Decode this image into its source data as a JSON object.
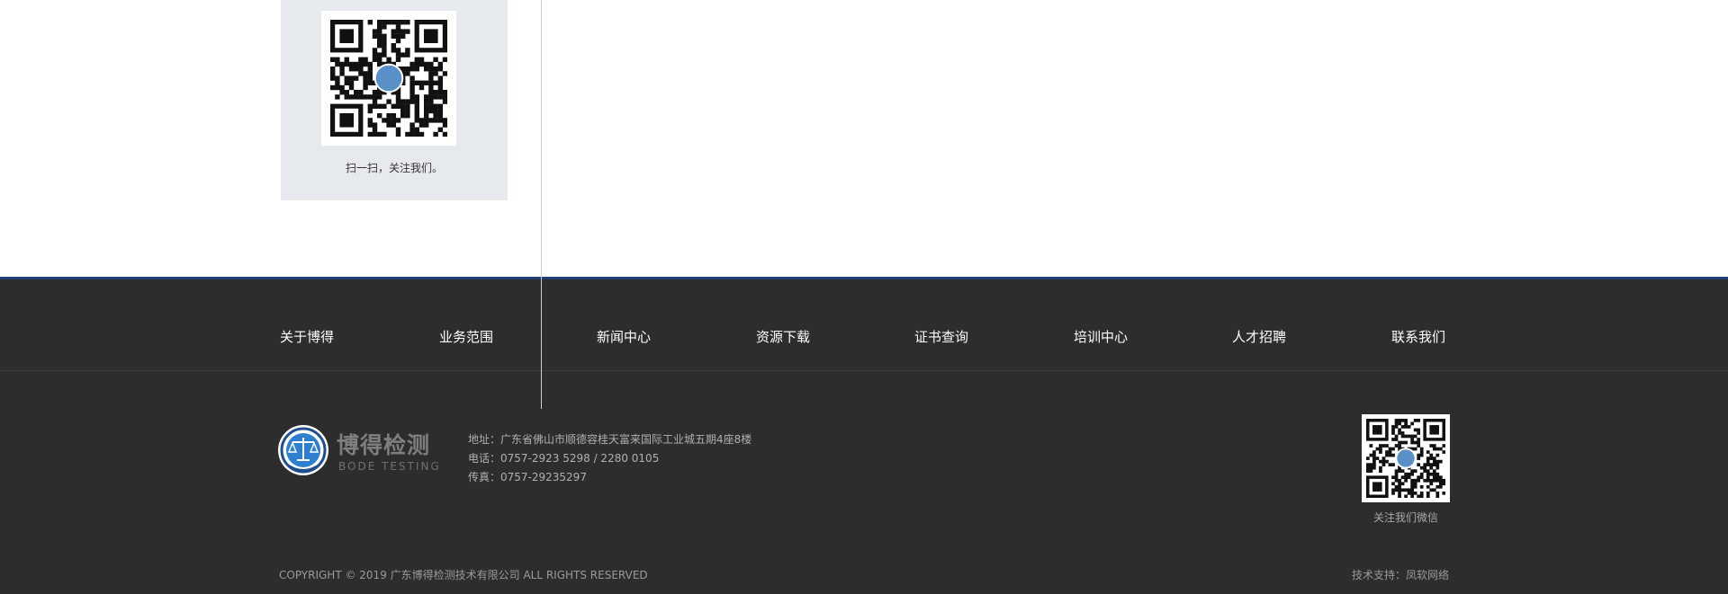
{
  "sidebar_qr": {
    "caption": "扫一扫，关注我们。",
    "icon": "qr-code-icon"
  },
  "footer": {
    "nav": [
      {
        "label": "关于博得"
      },
      {
        "label": "业务范围"
      },
      {
        "label": "新闻中心"
      },
      {
        "label": "资源下载"
      },
      {
        "label": "证书查询"
      },
      {
        "label": "培训中心"
      },
      {
        "label": "人才招聘"
      },
      {
        "label": "联系我们"
      }
    ],
    "logo": {
      "name_cn": "博得检测",
      "name_en": "BODE TESTING",
      "icon": "scales-of-justice-icon"
    },
    "contact": {
      "address": "地址：广东省佛山市顺德容桂天富来国际工业城五期4座8楼",
      "phone": "电话：0757-2923 5298 / 2280 0105",
      "fax": "传真：0757-29235297"
    },
    "wechat": {
      "caption": "关注我们微信",
      "icon": "qr-code-icon"
    },
    "copyright": "COPYRIGHT © 2019 广东博得检测技术有限公司  ALL RIGHTS RESERVED",
    "support_label": "技术支持：",
    "support_vendor": "凤软网络"
  },
  "colors": {
    "footer_bg": "#2d2d2d",
    "accent_line": "#1f3f73",
    "panel_bg": "#e6e9ee"
  }
}
